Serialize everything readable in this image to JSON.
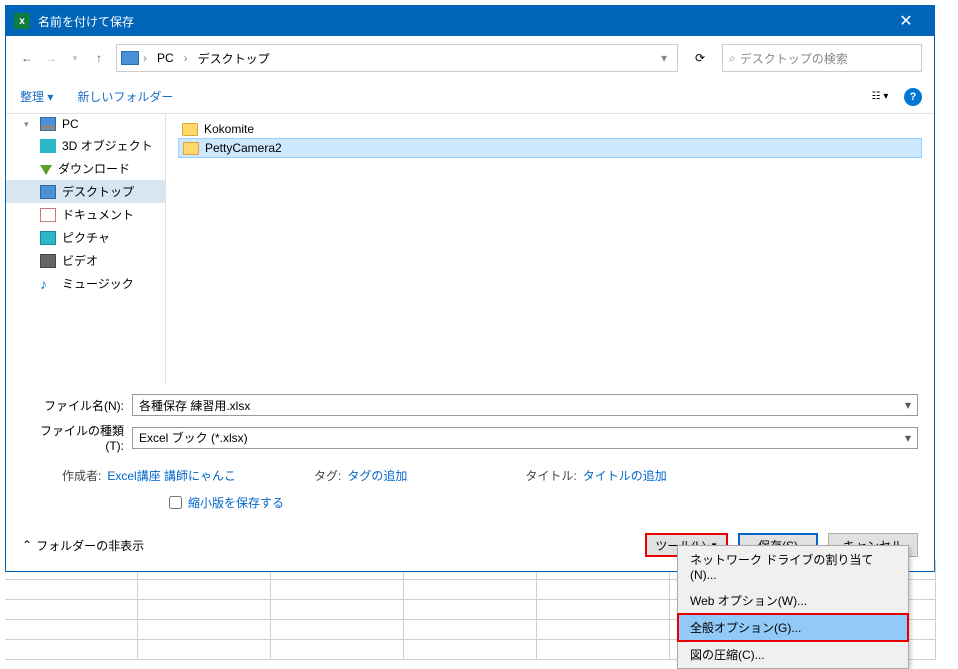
{
  "titlebar": {
    "title": "名前を付けて保存"
  },
  "breadcrumb": {
    "parts": [
      "PC",
      "デスクトップ"
    ],
    "dropdown_hint": "v"
  },
  "search": {
    "placeholder": "デスクトップの検索"
  },
  "toolbar": {
    "organize": "整理 ▾",
    "new_folder": "新しいフォルダー"
  },
  "sidebar": {
    "root": "PC",
    "items": [
      {
        "label": "3D オブジェクト"
      },
      {
        "label": "ダウンロード"
      },
      {
        "label": "デスクトップ"
      },
      {
        "label": "ドキュメント"
      },
      {
        "label": "ピクチャ"
      },
      {
        "label": "ビデオ"
      },
      {
        "label": "ミュージック"
      }
    ]
  },
  "files": [
    {
      "name": "Kokomite"
    },
    {
      "name": "PettyCamera2"
    }
  ],
  "form": {
    "filename_label": "ファイル名(N):",
    "filename_value": "各種保存 練習用.xlsx",
    "filetype_label": "ファイルの種類(T):",
    "filetype_value": "Excel ブック (*.xlsx)"
  },
  "meta": {
    "author_label": "作成者:",
    "author_value": "Excel講座 講師にゃんこ",
    "tag_label": "タグ:",
    "tag_value": "タグの追加",
    "title_label": "タイトル:",
    "title_value": "タイトルの追加",
    "thumb_label": "縮小版を保存する"
  },
  "footer": {
    "hide_folders": "フォルダーの非表示",
    "tools": "ツール(L)",
    "save": "保存(S)",
    "cancel": "キャンセル"
  },
  "dropdown": {
    "items": [
      "ネットワーク ドライブの割り当て(N)...",
      "Web オプション(W)...",
      "全般オプション(G)...",
      "図の圧縮(C)..."
    ]
  }
}
